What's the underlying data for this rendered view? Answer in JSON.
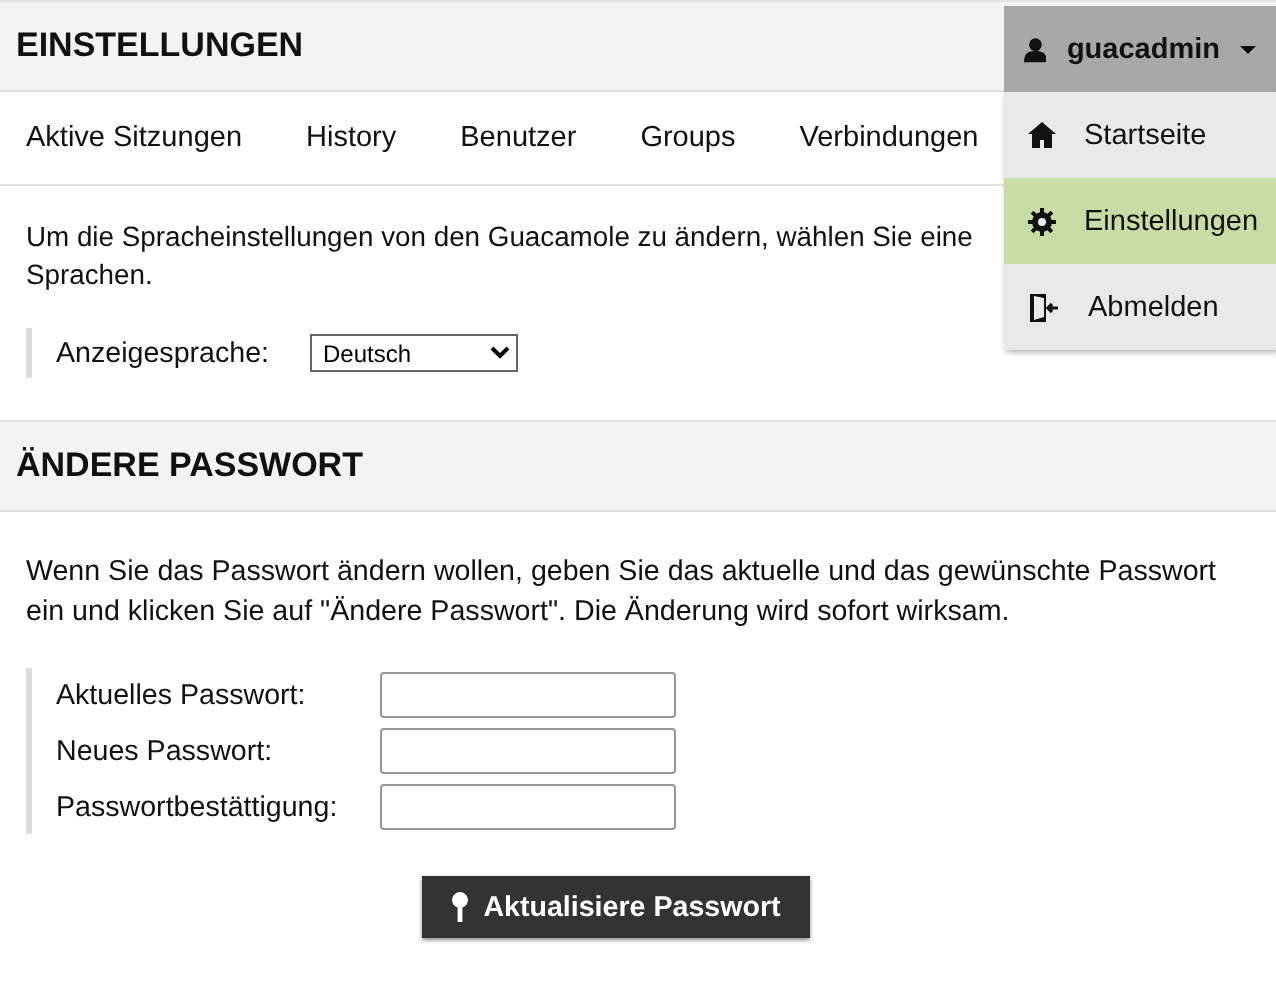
{
  "header": {
    "title": "EINSTELLUNGEN"
  },
  "user_menu": {
    "username": "guacadmin",
    "expanded": true,
    "items": [
      {
        "label": "Startseite",
        "selected": false
      },
      {
        "label": "Einstellungen",
        "selected": true
      },
      {
        "label": "Abmelden",
        "selected": false
      }
    ]
  },
  "tabs": [
    {
      "label": "Aktive Sitzungen"
    },
    {
      "label": "History"
    },
    {
      "label": "Benutzer"
    },
    {
      "label": "Groups"
    },
    {
      "label": "Verbindungen"
    }
  ],
  "language": {
    "intro_lines": [
      "Um die Spracheinstellungen von den Guacamole zu ändern, wählen Sie eine",
      "Sprachen."
    ],
    "label": "Anzeigesprache:",
    "value": "Deutsch"
  },
  "password": {
    "title": "ÄNDERE PASSWORT",
    "description": "Wenn Sie das Passwort ändern wollen, geben Sie das aktuelle und das gewünschte Passwort ein und klicken Sie auf \"Ändere Passwort\". Die Änderung wird sofort wirksam.",
    "fields": [
      {
        "label": "Aktuelles Passwort:"
      },
      {
        "label": "Neues Passwort:"
      },
      {
        "label": "Passwortbestättigung:"
      }
    ],
    "button": "Aktualisiere Passwort"
  }
}
